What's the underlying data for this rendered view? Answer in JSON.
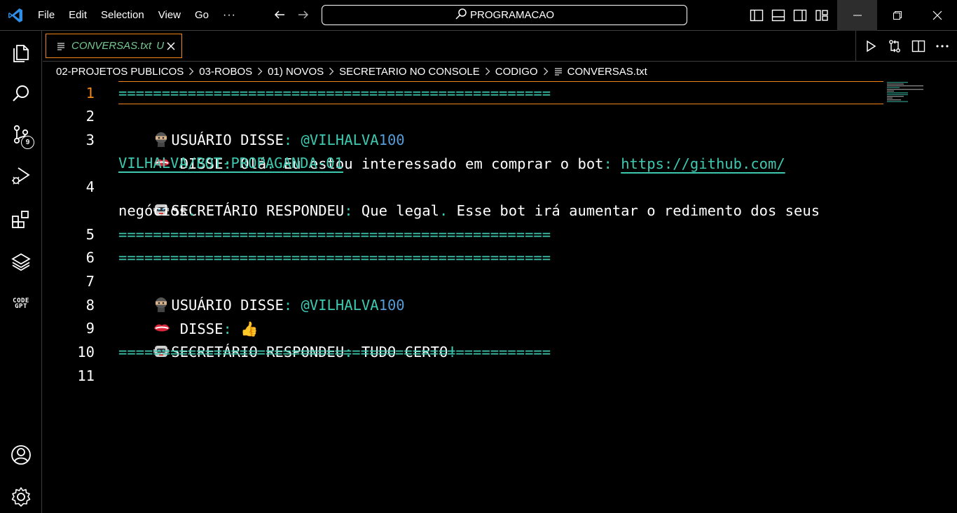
{
  "titlebar": {
    "menu": [
      "File",
      "Edit",
      "Selection",
      "View",
      "Go"
    ],
    "more": "···",
    "search_text": "PROGRAMACAO"
  },
  "activity": {
    "source_control_badge": "9",
    "codegpt_line1": "CODE",
    "codegpt_line2": "GPT"
  },
  "tab": {
    "label": "CONVERSAS.txt",
    "status": "U"
  },
  "breadcrumb": {
    "items": [
      "02-PROJETOS PUBLICOS",
      "03-ROBOS",
      "01) NOVOS",
      "SECRETARIO NO CONSOLE",
      "CODIGO"
    ],
    "file": "CONVERSAS.txt"
  },
  "editor": {
    "line_numbers": [
      "1",
      "2",
      "3",
      "4",
      "5",
      "6",
      "7",
      "8",
      "9",
      "10",
      "11"
    ],
    "separator": "==================================================",
    "user_label": "USUÁRIO DISSE",
    "user_handle": "@VILHALVA",
    "user_handle_num": "100",
    "disse_label": "DISSE",
    "msg1_text": " Olá",
    "msg1_text2": " Eu estou interessado em comprar o bot",
    "link1": "https://github.com/",
    "link2": "VILHALVA/BOT-PROPAGANDA-01",
    "secretary_label": "SECRETÁRIO RESPONDEU",
    "resp1_text": " Que legal",
    "resp1_text2": " Esse bot irá aumentar o redimento dos seus",
    "resp1_cont": "negócios",
    "resp2_text": " TUDO CERTO",
    "thumbs": "👍"
  }
}
